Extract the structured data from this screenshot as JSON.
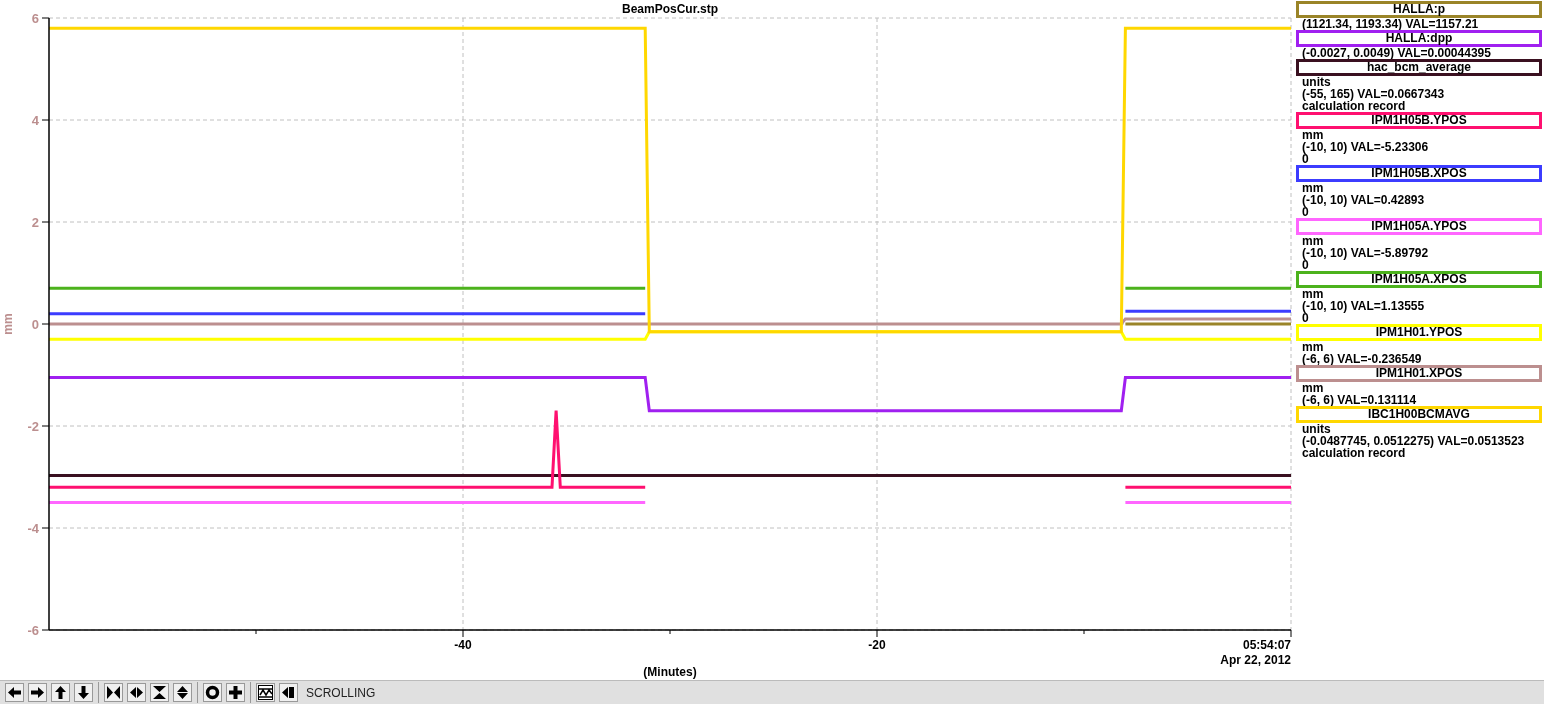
{
  "chart": {
    "title": "BeamPosCur.stp",
    "end_time": "05:54:07",
    "date_label": "Apr 22, 2012",
    "chart_data": {
      "type": "line",
      "xlabel": "(Minutes)",
      "ylabel": "mm",
      "grid": true,
      "x": [
        -60,
        -35.7,
        -35.5,
        -35.3,
        -31.2,
        -31.0,
        -8.2,
        -8.0,
        0
      ],
      "xlim": [
        -60,
        0
      ],
      "ylim": [
        -6,
        6
      ],
      "xticks": [
        -40,
        -20
      ],
      "yticks": [
        -6,
        -4,
        -2,
        0,
        2,
        4,
        6
      ],
      "series": [
        {
          "name": "HALLA:p",
          "color": "#9a8428",
          "values": [
            null,
            null,
            null,
            null,
            null,
            null,
            null,
            0,
            0
          ]
        },
        {
          "name": "HALLA:dpp",
          "color": "#a020f0",
          "values": [
            -1.05,
            -1.05,
            -1.05,
            -1.05,
            -1.05,
            -1.7,
            -1.7,
            -1.05,
            -1.05
          ]
        },
        {
          "name": "hac_bcm_average",
          "color": "#3a1020",
          "values": [
            -2.97,
            -2.97,
            -2.97,
            -2.97,
            -2.97,
            -2.97,
            -2.97,
            -2.97,
            -2.97
          ]
        },
        {
          "name": "IPM1H05B.YPOS",
          "color": "#ff1070",
          "values": [
            -3.2,
            -3.2,
            -1.7,
            -3.2,
            -3.2,
            null,
            null,
            -3.2,
            -3.2
          ]
        },
        {
          "name": "IPM1H05B.XPOS",
          "color": "#3c3cff",
          "values": [
            0.2,
            0.2,
            0.2,
            0.2,
            0.2,
            null,
            null,
            0.25,
            0.25
          ]
        },
        {
          "name": "IPM1H05A.YPOS",
          "color": "#ff66ff",
          "values": [
            -3.5,
            -3.5,
            -3.5,
            -3.5,
            -3.5,
            null,
            null,
            -3.5,
            -3.5
          ]
        },
        {
          "name": "IPM1H05A.XPOS",
          "color": "#4cb21c",
          "values": [
            0.7,
            0.7,
            0.7,
            0.7,
            0.7,
            null,
            null,
            0.7,
            0.7
          ]
        },
        {
          "name": "IPM1H01.YPOS",
          "color": "#ffff00",
          "values": [
            -0.3,
            -0.3,
            -0.3,
            -0.3,
            -0.3,
            -0.15,
            -0.15,
            -0.3,
            -0.3
          ]
        },
        {
          "name": "IPM1H01.XPOS",
          "color": "#bc8f8f",
          "values": [
            0,
            0,
            0,
            0,
            0,
            0,
            0,
            0.1,
            0.1
          ]
        },
        {
          "name": "IBC1H00BCMAVG",
          "color": "#ffd700",
          "values": [
            5.8,
            5.8,
            5.8,
            5.8,
            5.8,
            -0.15,
            -0.15,
            5.8,
            5.8
          ]
        }
      ]
    }
  },
  "legend": [
    {
      "lines": [
        "(1121.34, 1193.34) VAL=1157.21"
      ]
    },
    {
      "lines": [
        "(-0.0027, 0.0049) VAL=0.00044395"
      ]
    },
    {
      "lines": [
        "units",
        "(-55, 165) VAL=0.0667343",
        "calculation record"
      ]
    },
    {
      "lines": [
        "mm",
        "(-10, 10) VAL=-5.23306",
        "0"
      ]
    },
    {
      "lines": [
        "mm",
        "(-10, 10) VAL=0.42893",
        "0"
      ]
    },
    {
      "lines": [
        "mm",
        "(-10, 10) VAL=-5.89792",
        "0"
      ]
    },
    {
      "lines": [
        "mm",
        "(-10, 10) VAL=1.13555",
        "0"
      ]
    },
    {
      "lines": [
        "mm",
        "(-6, 6) VAL=-0.236549"
      ]
    },
    {
      "lines": [
        "mm",
        "(-6, 6) VAL=0.131114"
      ]
    },
    {
      "lines": [
        "units",
        "(-0.0487745, 0.0512275) VAL=0.0513523",
        "calculation record"
      ]
    }
  ],
  "toolbar": {
    "mode": "SCROLLING"
  }
}
